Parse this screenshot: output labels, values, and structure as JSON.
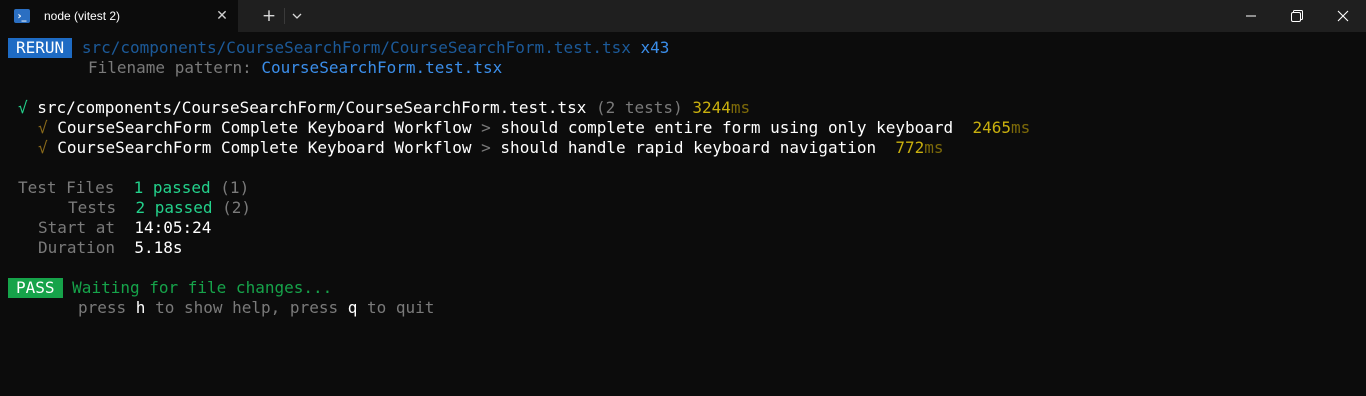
{
  "window": {
    "tab_title": "node (vitest 2)",
    "tab_close": "✕",
    "new_tab": "+",
    "ps_icon": "›_"
  },
  "colors": {
    "background": "#0c0c0c",
    "accent_blue": "#1e6bc4",
    "pass_green": "#16a34a",
    "text_green": "#23d18b",
    "time_yellow": "#c9b00e"
  },
  "terminal": {
    "rerun": {
      "badge": "RERUN",
      "path": "src/components/CourseSearchForm/CourseSearchForm.test.tsx",
      "count": "x43",
      "pattern_label": "Filename pattern: ",
      "pattern_value": "CourseSearchForm.test.tsx"
    },
    "suite": {
      "check": "√",
      "path": "src/components/CourseSearchForm/CourseSearchForm.test.tsx",
      "tests_info": "(2 tests)",
      "time": "3244",
      "time_unit": "ms"
    },
    "tests": [
      {
        "check": "√",
        "describe": "CourseSearchForm Complete Keyboard Workflow",
        "arrow": ">",
        "name": "should complete entire form using only keyboard",
        "time": "2465",
        "unit": "ms"
      },
      {
        "check": "√",
        "describe": "CourseSearchForm Complete Keyboard Workflow",
        "arrow": ">",
        "name": "should handle rapid keyboard navigation",
        "time": "772",
        "unit": "ms"
      }
    ],
    "summary": {
      "test_files_label": "Test Files",
      "test_files_value": "1 passed",
      "test_files_total": "(1)",
      "tests_label": "Tests",
      "tests_value": "2 passed",
      "tests_total": "(2)",
      "start_label": "Start at",
      "start_value": "14:05:24",
      "duration_label": "Duration",
      "duration_value": "5.18s"
    },
    "status": {
      "badge": "PASS",
      "waiting": "Waiting for file changes...",
      "help_1": "press ",
      "help_key_h": "h",
      "help_2": " to show help, press ",
      "help_key_q": "q",
      "help_3": " to quit"
    }
  }
}
